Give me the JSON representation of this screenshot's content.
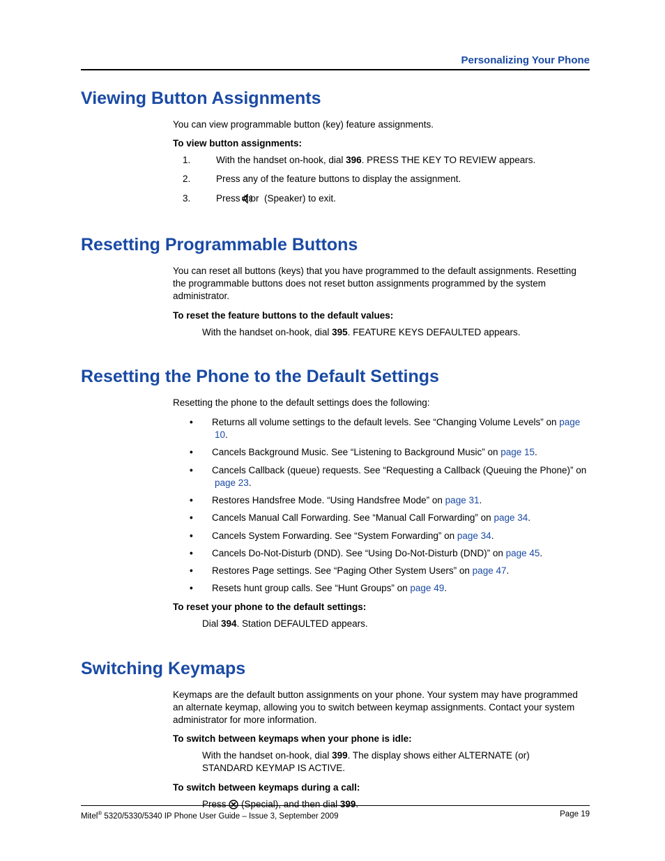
{
  "header": {
    "chapter": "Personalizing Your Phone"
  },
  "s1": {
    "title": "Viewing Button Assignments",
    "intro": "You can view programmable button (key) feature assignments.",
    "sub": "To view button assignments:",
    "li1_a": "With the handset on-hook, dial ",
    "li1_code": "396",
    "li1_b": ". PRESS THE KEY TO REVIEW appears.",
    "li2": "Press any of the feature buttons to display the assignment.",
    "li3_a": "Press ",
    "li3_hash": "#",
    "li3_b": " or  ",
    "li3_c": " (Speaker) to exit."
  },
  "s2": {
    "title": "Resetting Programmable Buttons",
    "intro": "You can reset all buttons (keys) that you have programmed to the default assignments. Resetting the programmable buttons does not reset button assignments programmed by the system administrator.",
    "sub": "To reset the feature buttons to the default values:",
    "act_a": "With the handset on-hook, dial ",
    "act_code": "395",
    "act_b": ". FEATURE KEYS DEFAULTED appears."
  },
  "s3": {
    "title": "Resetting the Phone to the Default Settings",
    "intro": "Resetting the phone to the default settings does the following:",
    "b1_a": "Returns all volume settings to the default levels. See “Changing Volume Levels” on ",
    "b1_l": "page 10",
    "b1_e": ".",
    "b2_a": "Cancels Background Music. See “Listening to Background Music” on ",
    "b2_l": "page 15",
    "b2_e": ".",
    "b3_a": "Cancels Callback (queue) requests. See “Requesting a Callback (Queuing the Phone)” on ",
    "b3_l": "page 23",
    "b3_e": ".",
    "b4_a": "Restores Handsfree Mode. “Using Handsfree Mode” on ",
    "b4_l": "page 31",
    "b4_e": ".",
    "b5_a": "Cancels Manual Call Forwarding. See “Manual Call Forwarding” on ",
    "b5_l": "page 34",
    "b5_e": ".",
    "b6_a": "Cancels System Forwarding. See “System Forwarding” on ",
    "b6_l": "page 34",
    "b6_e": ".",
    "b7_a": "Cancels Do-Not-Disturb (DND). See “Using Do-Not-Disturb (DND)” on ",
    "b7_l": "page 45",
    "b7_e": ".",
    "b8_a": "Restores Page settings. See “Paging Other System Users” on ",
    "b8_l": "page 47",
    "b8_e": ".",
    "b9_a": "Resets hunt group calls. See “Hunt Groups” on ",
    "b9_l": "page 49",
    "b9_e": ".",
    "sub": "To reset your phone to the default settings:",
    "act_a": "Dial ",
    "act_code": "394",
    "act_b": ". Station DEFAULTED appears."
  },
  "s4": {
    "title": "Switching Keymaps",
    "intro": "Keymaps are the default button assignments on your phone. Your system may have programmed an alternate keymap, allowing you to switch between keymap assignments. Contact your system administrator for more information.",
    "sub1": "To switch between keymaps when your phone is idle:",
    "a1_a": "With the handset on-hook, dial ",
    "a1_code": "399",
    "a1_b": ". The display shows either ALTERNATE (or) STANDARD KEYMAP IS ACTIVE.",
    "sub2": "To switch between keymaps during a call:",
    "a2_a": "Press ",
    "a2_b": " (Special), and then dial ",
    "a2_code": "399",
    "a2_c": "."
  },
  "footer": {
    "left_a": "Mitel",
    "left_sup": "®",
    "left_b": " 5320/5330/5340 IP Phone User Guide – Issue 3, September 2009",
    "right": "Page 19"
  }
}
